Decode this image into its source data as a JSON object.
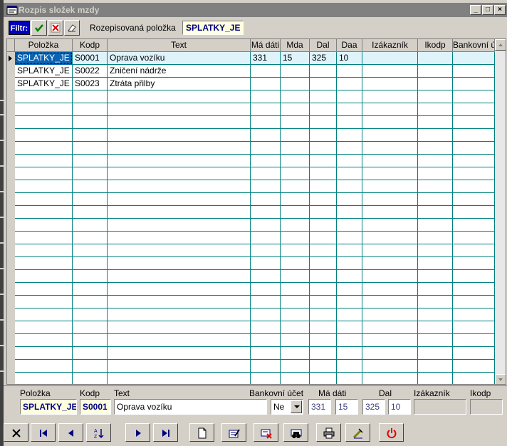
{
  "window": {
    "title": "Rozpis složek mzdy"
  },
  "filter": {
    "badge": "Filtr:",
    "label": "Rozepisovaná položka",
    "value": "SPLATKY_JE"
  },
  "grid": {
    "columns": [
      "Položka",
      "Kodp",
      "Text",
      "Má dáti",
      "Mda",
      "Dal",
      "Daa",
      "Izákazník",
      "Ikodp",
      "Bankovní ú"
    ],
    "rows": [
      [
        "SPLATKY_JE",
        "S0001",
        "Oprava vozíku",
        "331",
        "15",
        "325",
        "10",
        "",
        "",
        ""
      ],
      [
        "SPLATKY_JE",
        "S0022",
        "Zničení nádrže",
        "",
        "",
        "",
        "",
        "",
        "",
        ""
      ],
      [
        "SPLATKY_JE",
        "S0023",
        "Ztráta přilby",
        "",
        "",
        "",
        "",
        "",
        "",
        ""
      ]
    ]
  },
  "detail": {
    "labels": {
      "polozka": "Položka",
      "kodp": "Kodp",
      "text": "Text",
      "bank": "Bankovní účet",
      "madati": "Má dáti",
      "dal": "Dal",
      "izakaznik": "Izákazník",
      "ikodp": "Ikodp"
    },
    "values": {
      "polozka": "SPLATKY_JE",
      "kodp": "S0001",
      "text": "Oprava vozíku",
      "bank": "Ne",
      "madati": "331",
      "mda": "15",
      "dal": "325",
      "daa": "10",
      "izakaznik": "",
      "ikodp": ""
    }
  },
  "colors": {
    "title_bar": "#808080",
    "selection": "#0a64b4",
    "grid_line": "#008080",
    "power_icon": "#e00000"
  }
}
